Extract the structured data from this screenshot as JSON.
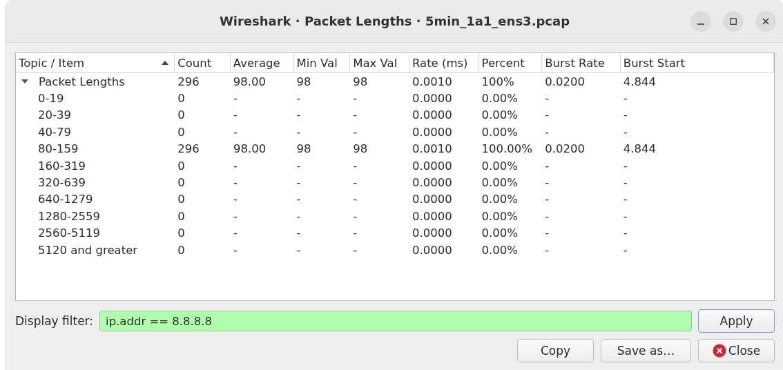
{
  "window": {
    "title": "Wireshark · Packet Lengths · 5min_1a1_ens3.pcap"
  },
  "table": {
    "columns": [
      {
        "label": "Topic / Item",
        "sorted": true
      },
      {
        "label": "Count",
        "sorted": false
      },
      {
        "label": "Average",
        "sorted": false
      },
      {
        "label": "Min Val",
        "sorted": false
      },
      {
        "label": "Max Val",
        "sorted": false
      },
      {
        "label": "Rate (ms)",
        "sorted": false
      },
      {
        "label": "Percent",
        "sorted": false
      },
      {
        "label": "Burst Rate",
        "sorted": false
      },
      {
        "label": "Burst Start",
        "sorted": false
      }
    ],
    "rows": [
      {
        "cells": [
          "Packet Lengths",
          "296",
          "98.00",
          "98",
          "98",
          "0.0010",
          "100%",
          "0.0200",
          "4.844"
        ],
        "expanded": true,
        "children": [
          {
            "cells": [
              "0-19",
              "0",
              "-",
              "-",
              "-",
              "0.0000",
              "0.00%",
              "-",
              "-"
            ]
          },
          {
            "cells": [
              "20-39",
              "0",
              "-",
              "-",
              "-",
              "0.0000",
              "0.00%",
              "-",
              "-"
            ]
          },
          {
            "cells": [
              "40-79",
              "0",
              "-",
              "-",
              "-",
              "0.0000",
              "0.00%",
              "-",
              "-"
            ]
          },
          {
            "cells": [
              "80-159",
              "296",
              "98.00",
              "98",
              "98",
              "0.0010",
              "100.00%",
              "0.0200",
              "4.844"
            ]
          },
          {
            "cells": [
              "160-319",
              "0",
              "-",
              "-",
              "-",
              "0.0000",
              "0.00%",
              "-",
              "-"
            ]
          },
          {
            "cells": [
              "320-639",
              "0",
              "-",
              "-",
              "-",
              "0.0000",
              "0.00%",
              "-",
              "-"
            ]
          },
          {
            "cells": [
              "640-1279",
              "0",
              "-",
              "-",
              "-",
              "0.0000",
              "0.00%",
              "-",
              "-"
            ]
          },
          {
            "cells": [
              "1280-2559",
              "0",
              "-",
              "-",
              "-",
              "0.0000",
              "0.00%",
              "-",
              "-"
            ]
          },
          {
            "cells": [
              "2560-5119",
              "0",
              "-",
              "-",
              "-",
              "0.0000",
              "0.00%",
              "-",
              "-"
            ]
          },
          {
            "cells": [
              "5120 and greater",
              "0",
              "-",
              "-",
              "-",
              "0.0000",
              "0.00%",
              "-",
              "-"
            ]
          }
        ]
      }
    ]
  },
  "filter": {
    "label": "Display filter:",
    "value": "ip.addr == 8.8.8.8",
    "valid": true,
    "apply": "Apply"
  },
  "buttons": [
    {
      "label": "Copy",
      "kind": "plain"
    },
    {
      "label": "Save as…",
      "kind": "plain"
    },
    {
      "label": "Close",
      "kind": "close"
    }
  ]
}
